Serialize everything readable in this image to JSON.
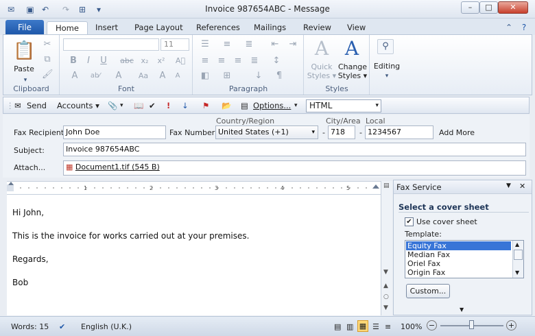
{
  "window": {
    "title": "Invoice 987654ABC - Message",
    "controls": {
      "minimize": "–",
      "maximize": "□",
      "close": "✕"
    }
  },
  "ribbon_tabs": {
    "file": "File",
    "items": [
      "Home",
      "Insert",
      "Page Layout",
      "References",
      "Mailings",
      "Review",
      "View"
    ],
    "active": "Home"
  },
  "ribbon": {
    "clipboard": {
      "paste": "Paste",
      "label": "Clipboard"
    },
    "font": {
      "font_size": "11",
      "label": "Font"
    },
    "paragraph": {
      "label": "Paragraph"
    },
    "styles": {
      "quick_line1": "Quick",
      "quick_line2": "Styles ▾",
      "change_line1": "Change",
      "change_line2": "Styles ▾",
      "label": "Styles"
    },
    "editing": {
      "label": "Editing"
    }
  },
  "message_toolbar": {
    "send": "Send",
    "accounts": "Accounts ▾",
    "options": "Options...",
    "format": "HTML"
  },
  "fax_form": {
    "recipient_label": "Fax Recipient:",
    "recipient_value": "John Doe",
    "number_label": "Fax Number:",
    "country_label": "Country/Region",
    "country_value": "United States (+1)",
    "city_label": "City/Area",
    "city_value": "718",
    "local_label": "Local",
    "local_value": "1234567",
    "add_more": "Add More",
    "subject_label": "Subject:",
    "subject_value": "Invoice 987654ABC",
    "attach_label": "Attach...",
    "attachment": "Document1.tif (545 B)"
  },
  "message_body": {
    "lines": [
      "Hi John,",
      "This is the invoice for works carried out at your premises.",
      "Regards,",
      "Bob"
    ]
  },
  "fax_service": {
    "title": "Fax Service",
    "section": "Select a cover sheet",
    "use_cover_label": "Use cover sheet",
    "use_cover_checked": true,
    "template_label": "Template:",
    "templates": [
      "Equity Fax",
      "Median Fax",
      "Oriel Fax",
      "Origin Fax"
    ],
    "selected_template": "Equity Fax",
    "custom_button": "Custom..."
  },
  "status_bar": {
    "words": "Words: 15",
    "language": "English (U.K.)",
    "zoom": "100%",
    "zoom_fraction": 0.5
  },
  "colors": {
    "accent": "#1d56a8",
    "selection": "#3875d7"
  }
}
